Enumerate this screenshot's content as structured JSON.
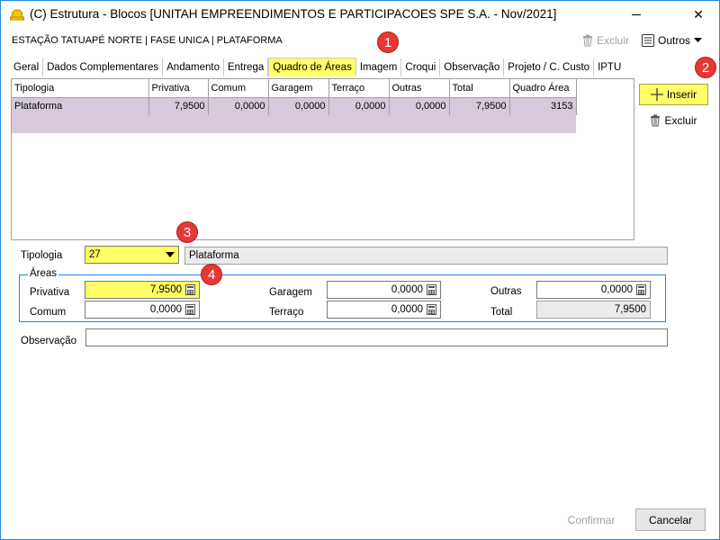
{
  "window": {
    "title": "(C) Estrutura - Blocos [UNITAH EMPREENDIMENTOS E PARTICIPACOES SPE S.A. - Nov/2021]",
    "close_glyph": "✕"
  },
  "header": {
    "title": "ESTAÇÃO TATUAPÉ NORTE | FASE UNICA | PLATAFORMA",
    "excluir_label": "Excluir",
    "outros_label": "Outros"
  },
  "tabs": [
    {
      "label": "Geral"
    },
    {
      "label": "Dados Complementares"
    },
    {
      "label": "Andamento"
    },
    {
      "label": "Entrega"
    },
    {
      "label": "Quadro de Áreas"
    },
    {
      "label": "Imagem"
    },
    {
      "label": "Croqui"
    },
    {
      "label": "Observação"
    },
    {
      "label": "Projeto / C. Custo"
    },
    {
      "label": "IPTU"
    }
  ],
  "grid": {
    "columns": [
      "Tipologia",
      "Privativa",
      "Comum",
      "Garagem",
      "Terraço",
      "Outras",
      "Total",
      "Quadro Área"
    ],
    "rows": [
      [
        "Plataforma",
        "7,9500",
        "0,0000",
        "0,0000",
        "0,0000",
        "0,0000",
        "7,9500",
        "3153"
      ]
    ]
  },
  "side": {
    "inserir_label": "Inserir",
    "excluir_label": "Excluir"
  },
  "markers": [
    "1",
    "2",
    "3",
    "4"
  ],
  "form": {
    "tipologia_label": "Tipologia",
    "tipologia_code": "27",
    "tipologia_name": "Plataforma",
    "areas_title": "Áreas",
    "privativa_label": "Privativa",
    "privativa_value": "7,9500",
    "comum_label": "Comum",
    "comum_value": "0,0000",
    "garagem_label": "Garagem",
    "garagem_value": "0,0000",
    "terraco_label": "Terraço",
    "terraco_value": "0,0000",
    "outras_label": "Outras",
    "outras_value": "0,0000",
    "total_label": "Total",
    "total_value": "7,9500",
    "observacao_label": "Observação",
    "observacao_value": ""
  },
  "footer": {
    "confirmar_label": "Confirmar",
    "cancelar_label": "Cancelar"
  },
  "colors": {
    "highlight": "#ffff66",
    "row_selected": "#d8c8dc",
    "marker": "#e53935",
    "accent": "#1e88e5"
  }
}
